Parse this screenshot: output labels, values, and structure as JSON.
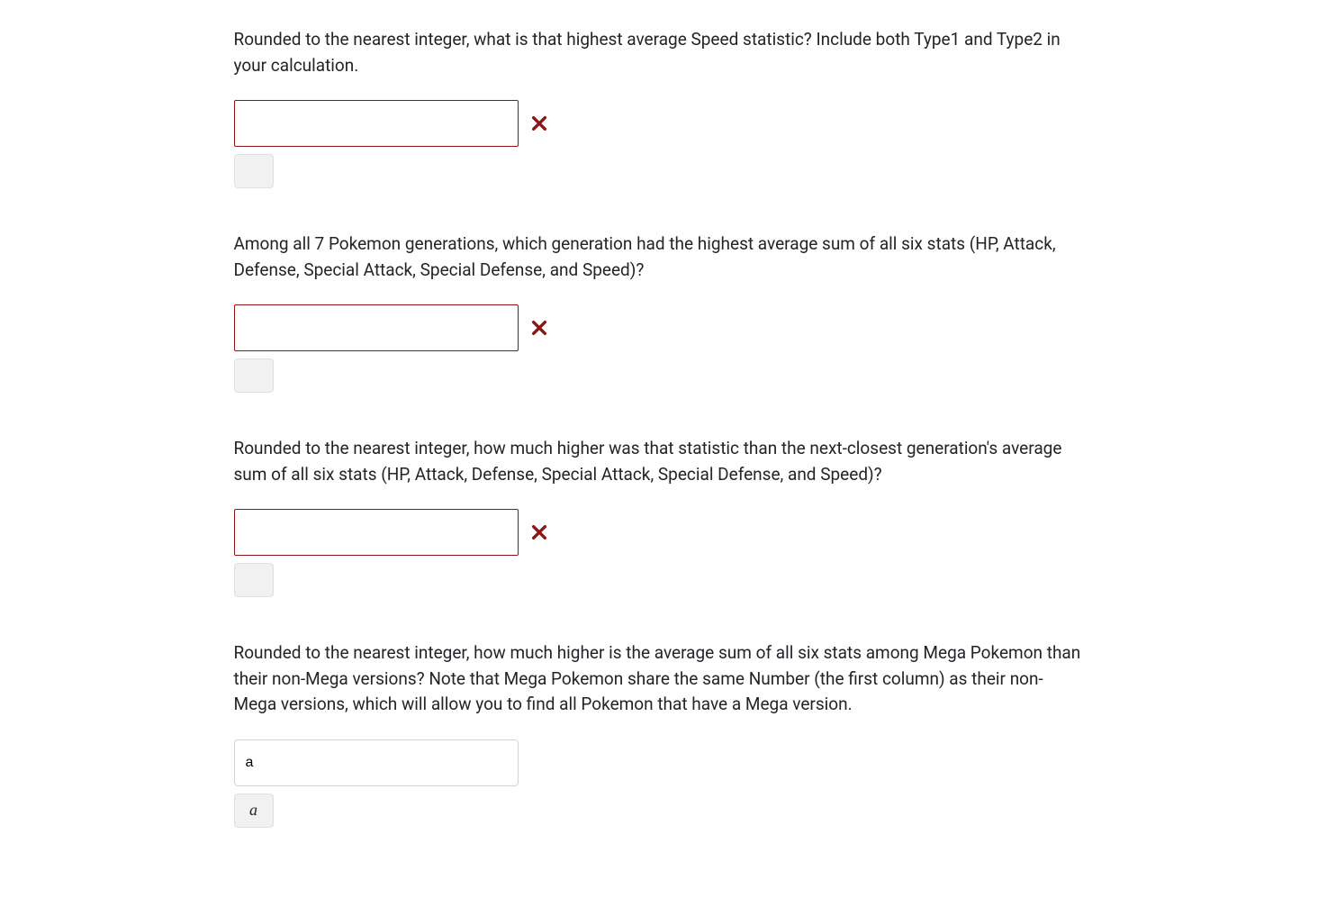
{
  "questions": [
    {
      "text": "Rounded to the nearest integer, what is that highest average Speed statistic? Include both Type1 and Type2 in your calculation.",
      "input_value": "",
      "status": "wrong",
      "preview": ""
    },
    {
      "text": "Among all 7 Pokemon generations, which generation had the highest average sum of all six stats (HP, Attack, Defense, Special Attack, Special Defense, and Speed)?",
      "input_value": "",
      "status": "wrong",
      "preview": ""
    },
    {
      "text": "Rounded to the nearest integer, how much higher was that statistic than the next-closest generation's average sum of all six stats (HP, Attack, Defense, Special Attack, Special Defense, and Speed)?",
      "input_value": "",
      "status": "wrong",
      "preview": ""
    },
    {
      "text": "Rounded to the nearest integer, how much higher is the average sum of all six stats among Mega Pokemon than their non-Mega versions? Note that Mega Pokemon share the same Number (the first column) as their non-Mega versions, which will allow you to find all Pokemon that have a Mega version.",
      "input_value": "a",
      "status": "neutral",
      "preview": "a"
    }
  ],
  "icons": {
    "wrong": "✖"
  }
}
